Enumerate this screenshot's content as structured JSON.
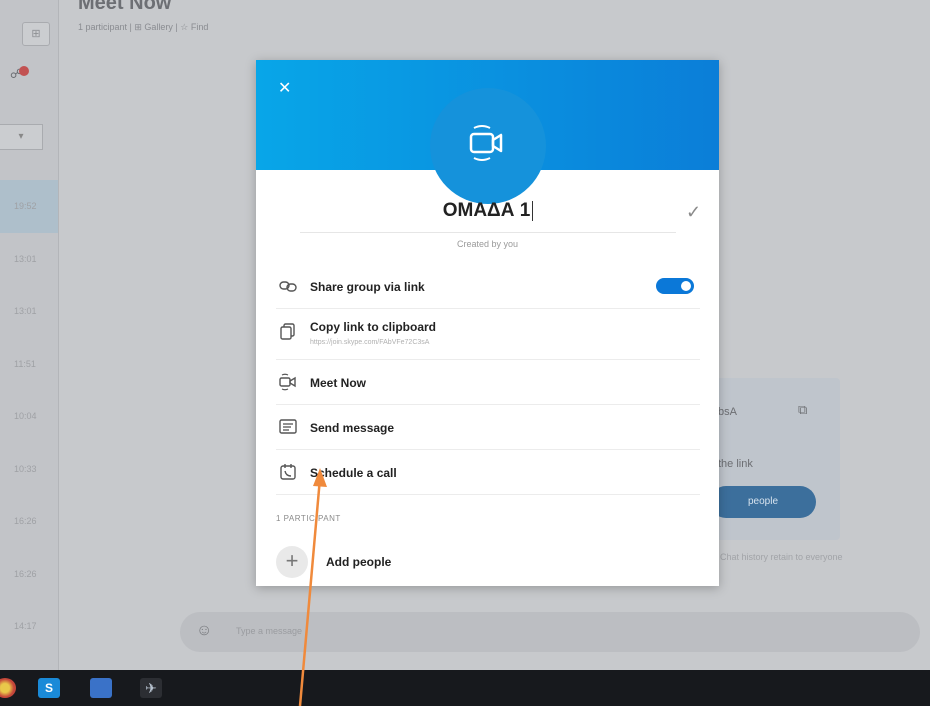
{
  "background": {
    "title": "Meet Now",
    "subtitle": "1 participant | ⊞ Gallery | ☆ Find",
    "rail_notification_badge": "",
    "times": [
      "19:52",
      "13:01",
      "13:01",
      "11:51",
      "10:04",
      "10:33",
      "16:26",
      "16:26",
      "14:17"
    ],
    "card_line1": "bsA",
    "card_line2": "the link",
    "card_button": "people",
    "note": "Chat history retain to everyone",
    "message_placeholder": "Type a message"
  },
  "modal": {
    "close_label": "✕",
    "group_name": "ΟΜΑΔΑ 1",
    "created_by": "Created by you",
    "share_label": "Share group via link",
    "share_enabled": true,
    "copy_label": "Copy link to clipboard",
    "copy_url": "https://join.skype.com/FAbVFe72C3sA",
    "meet_label": "Meet Now",
    "send_label": "Send message",
    "schedule_label": "Schedule a call",
    "participants_label": "1 PARTICIPANT",
    "add_people_label": "Add people"
  },
  "icons": {
    "avatar": "video-camera-icon",
    "share": "link-icon",
    "copy": "copy-icon",
    "meet": "video-camera-icon",
    "send": "message-icon",
    "schedule": "calendar-call-icon",
    "add": "plus-icon"
  },
  "colors": {
    "accent": "#0b78d8",
    "header_gradient_start": "#08a6e8",
    "header_gradient_end": "#0b7ed8",
    "arrow": "#f08a3c"
  },
  "taskbar": {
    "skype_label": "S"
  }
}
